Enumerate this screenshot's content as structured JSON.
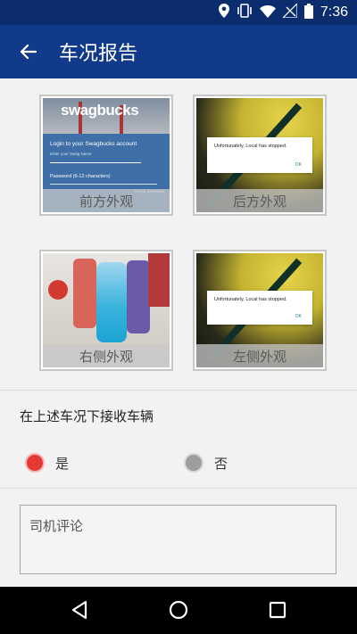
{
  "status_bar": {
    "time": "7:36",
    "icons": [
      "location-icon",
      "vibrate-icon",
      "wifi-icon",
      "no-signal-icon",
      "battery-icon"
    ]
  },
  "app_bar": {
    "title": "车况报告",
    "back_icon": "arrow-left-icon"
  },
  "photos": [
    {
      "label": "前方外观",
      "screen": {
        "logo": "swagbucks",
        "heading": "Login to your Swagbucks account",
        "email_placeholder": "Enter your Swag Name",
        "password_placeholder": "Password (6-12 characters)",
        "link": "Forgot password"
      }
    },
    {
      "label": "后方外观",
      "dialog": {
        "message": "Unfortunately, Local has stopped.",
        "ok": "OK"
      }
    },
    {
      "label": "右侧外观"
    },
    {
      "label": "左侧外观",
      "dialog": {
        "message": "Unfortunately, Local has stopped.",
        "ok": "OK"
      }
    }
  ],
  "question": "在上述车况下接收车辆",
  "options": [
    {
      "label": "是",
      "selected": true,
      "color": "#e53935"
    },
    {
      "label": "否",
      "selected": false,
      "color": "#9e9e9e"
    }
  ],
  "comment": {
    "placeholder": "司机评论"
  },
  "nav_bar": {
    "icons": [
      "back-triangle-icon",
      "home-circle-icon",
      "recents-square-icon"
    ]
  }
}
